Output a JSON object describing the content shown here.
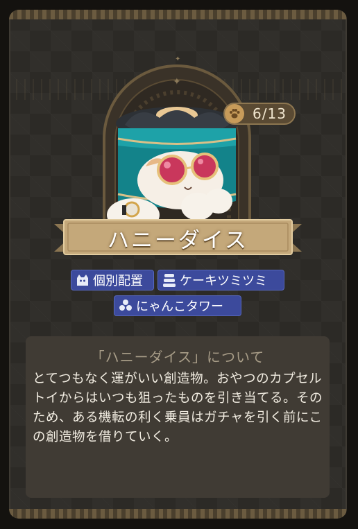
{
  "character": {
    "name": "ハニーダイス",
    "collection_count": "6/13"
  },
  "tags": [
    {
      "label": "個別配置",
      "icon": "cat-head-icon"
    },
    {
      "label": "ケーキツミツミ",
      "icon": "cake-stack-icon"
    },
    {
      "label": "にゃんこタワー",
      "icon": "cat-tower-icon"
    }
  ],
  "description": {
    "title": "「ハニーダイス」について",
    "body": "とてつもなく運がいい創造物。おやつのカプセルトイからはいつも狙ったものを引き当てる。そのため、ある機転の利く乗員はガチャを引く前にこの創造物を借りていく。"
  },
  "colors": {
    "tag_bg": "#3c4a9c",
    "banner": "#c4a87a",
    "card_bg": "#2c2a26",
    "cup_teal": "#13838a"
  }
}
